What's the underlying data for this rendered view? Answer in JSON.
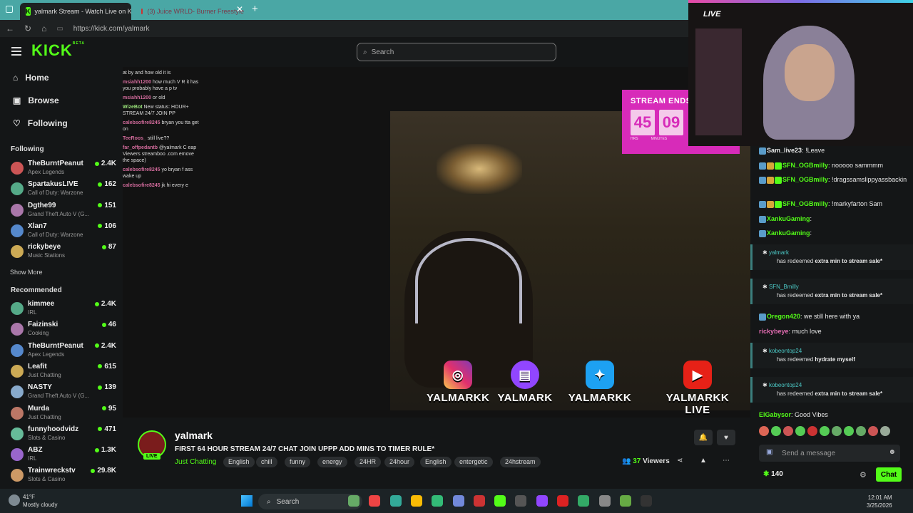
{
  "browser": {
    "tabs": [
      {
        "label": "yalmark Stream - Watch Live on Ki",
        "active": true
      },
      {
        "label": "(3) Juice WRLD- Burner Freestyle",
        "active": false
      }
    ],
    "url": "https://kick.com/yalmark"
  },
  "header": {
    "logo": "KICK",
    "logo_sup": "BETA",
    "search_placeholder": "Search"
  },
  "sidebar": {
    "nav": [
      "Home",
      "Browse",
      "Following"
    ],
    "following_title": "Following",
    "following": [
      {
        "name": "TheBurntPeanut",
        "category": "Apex Legends",
        "viewers": "2.4K"
      },
      {
        "name": "SpartakusLIVE",
        "category": "Call of Duty: Warzone",
        "viewers": "162"
      },
      {
        "name": "Dgthe99",
        "category": "Grand Theft Auto V (G...",
        "viewers": "151"
      },
      {
        "name": "Xlan7",
        "category": "Call of Duty: Warzone",
        "viewers": "106"
      },
      {
        "name": "rickybeye",
        "category": "Music Stations",
        "viewers": "87"
      }
    ],
    "show_more": "Show More",
    "recommended_title": "Recommended",
    "recommended": [
      {
        "name": "kimmee",
        "category": "IRL",
        "viewers": "2.4K"
      },
      {
        "name": "Faizinski",
        "category": "Cooking",
        "viewers": "46"
      },
      {
        "name": "TheBurntPeanut",
        "category": "Apex Legends",
        "viewers": "2.4K"
      },
      {
        "name": "Leafit",
        "category": "Just Chatting",
        "viewers": "615"
      },
      {
        "name": "NASTY",
        "category": "Grand Theft Auto V (G...",
        "viewers": "139"
      },
      {
        "name": "Murda",
        "category": "Just Chatting",
        "viewers": "95"
      },
      {
        "name": "funnyhoodvidz",
        "category": "Slots & Casino",
        "viewers": "471"
      },
      {
        "name": "ABZ",
        "category": "IRL",
        "viewers": "1.3K"
      },
      {
        "name": "Trainwreckstv",
        "category": "Slots & Casino",
        "viewers": "29.8K"
      }
    ]
  },
  "video": {
    "overlay_chat": [
      {
        "user": "",
        "text": "at by and how old it is"
      },
      {
        "user": "msiahh1200",
        "text": "how much V R it has you probably have a p tv"
      },
      {
        "user": "msiahh1200",
        "text": "or old"
      },
      {
        "user": "WizeBot",
        "text": "New status: HOUR+ STREAM 24/7 JOIN PP"
      },
      {
        "user": "calebsofire8245",
        "text": "bryan you tta get on"
      },
      {
        "user": "TeeRoos_",
        "text": "still live??"
      },
      {
        "user": "far_offpedantb",
        "text": "@yalmark C eap Viewers streamboo .com emove the space)"
      },
      {
        "user": "calebsofire8245",
        "text": "yo bryan f ass wake up"
      },
      {
        "user": "calebsofire8245",
        "text": "jk hi every e"
      }
    ],
    "timer": {
      "title": "STREAM ENDS",
      "hours": "45",
      "minutes": "09",
      "hours_label": "HRS",
      "minutes_label": "MINUTES"
    },
    "socials": [
      {
        "icon": "instagram-icon",
        "label": "YALMARKK"
      },
      {
        "icon": "twitch-icon",
        "label": "YALMARK"
      },
      {
        "icon": "twitter-icon",
        "label": "YALMARKK"
      },
      {
        "icon": "youtube-icon",
        "label": "YALMARKK LIVE"
      }
    ],
    "webcam_label": "LIVE"
  },
  "stream": {
    "name": "yalmark",
    "live_badge": "LIVE",
    "title": "FIRST 64 HOUR STREAM 24/7 CHAT JOIN UPPP ADD MINS TO TIMER RULE*",
    "category": "Just Chatting",
    "tags": [
      "English",
      "chill",
      "funny",
      "energy",
      "24HR",
      "24hour",
      "English",
      "entergetic",
      "24hstream"
    ],
    "viewers": "37",
    "viewers_label": "Viewers"
  },
  "chat": {
    "messages": [
      {
        "user": "Sam_live23",
        "user_color": "#e8e8e8",
        "text": "!Leave"
      },
      {
        "user": "SFN_OGBmilly",
        "user_color": "#53fc18",
        "text": "nooooo sammmm"
      },
      {
        "user": "SFN_OGBmilly",
        "user_color": "#53fc18",
        "text": "!dragssamslippyassbackin"
      },
      {
        "user": "SFN_OGBmilly",
        "user_color": "#53fc18",
        "text": "!markyfarton Sam"
      },
      {
        "user": "XankuGaming",
        "user_color": "#53fc18",
        "text": ""
      },
      {
        "user": "XankuGaming",
        "user_color": "#53fc18",
        "text": ""
      }
    ],
    "redeems": [
      {
        "user": "yalmark",
        "text": "has redeemed",
        "reward": "extra min to stream sale*"
      },
      {
        "user": "SFN_Bmilly",
        "text": "has redeemed",
        "reward": "extra min to stream sale*"
      }
    ],
    "messages2": [
      {
        "user": "Oregon420",
        "user_color": "#53fc18",
        "text": "we still here with ya"
      },
      {
        "user": "rickybeye",
        "user_color": "#e06bb0",
        "text": "much love"
      }
    ],
    "redeems2": [
      {
        "user": "kobeontop24",
        "text": "has redeemed",
        "reward": "hydrate myself"
      },
      {
        "user": "kobeontop24",
        "text": "has redeemed",
        "reward": "extra min to stream sale*"
      }
    ],
    "last_message": {
      "user": "ElGabysor",
      "user_color": "#53fc18",
      "text": "Good Vibes"
    },
    "input_placeholder": "Send a message",
    "points": "140",
    "chat_button": "Chat"
  },
  "taskbar": {
    "temperature": "41°F",
    "weather": "Mostly cloudy",
    "search": "Search",
    "time": "12:01 AM",
    "date": "3/25/2026"
  }
}
